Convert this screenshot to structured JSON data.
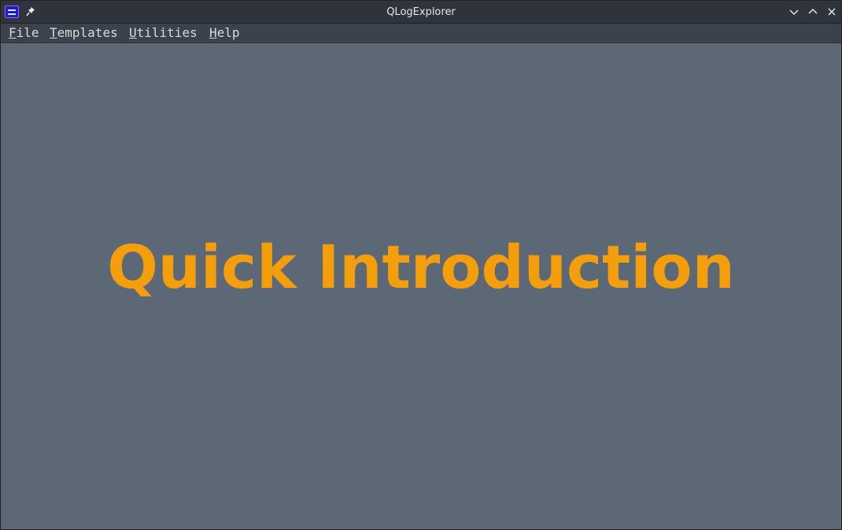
{
  "window": {
    "title": "QLogExplorer",
    "icons": {
      "app": "app-menu-icon",
      "pin": "pin-icon",
      "minimize": "chevron-down-icon",
      "maximize": "chevron-up-icon",
      "close": "close-icon"
    }
  },
  "menubar": {
    "file": {
      "mnemonic": "F",
      "rest": "ile"
    },
    "templates": {
      "mnemonic": "T",
      "rest": "emplates"
    },
    "utilities": {
      "mnemonic": "U",
      "rest": "tilities"
    },
    "help": {
      "mnemonic": "H",
      "rest": "elp"
    }
  },
  "main": {
    "heading": "Quick Introduction"
  },
  "colors": {
    "background": "#5d6877",
    "heading": "#f59e0b",
    "titlebar": "#2f343c",
    "menubar": "#3b424c"
  }
}
